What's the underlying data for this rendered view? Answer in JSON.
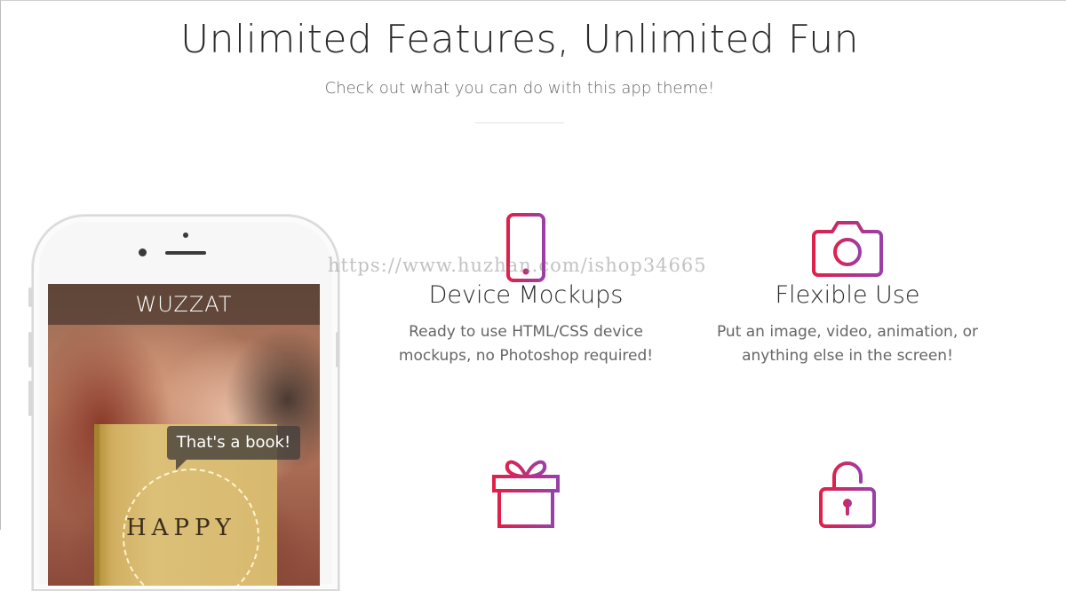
{
  "section": {
    "title": "Unlimited Features, Unlimited Fun",
    "subtitle": "Check out what you can do with this app theme!"
  },
  "phone_screen": {
    "app_title": "WUZZAT",
    "bubble": "That's a book!",
    "book_text": "HAPPY"
  },
  "features": [
    {
      "icon": "smartphone-icon",
      "title": "Device Mockups",
      "desc_line1": "Ready to use HTML/CSS device",
      "desc_line2": "mockups, no Photoshop required!"
    },
    {
      "icon": "camera-icon",
      "title": "Flexible Use",
      "desc_line1": "Put an image, video, animation, or",
      "desc_line2": "anything else in the screen!"
    },
    {
      "icon": "gift-icon"
    },
    {
      "icon": "unlock-icon"
    }
  ],
  "watermark": "https://www.huzhan.com/ishop34665",
  "colors": {
    "icon_gradient_start": "#e0204a",
    "icon_gradient_end": "#9a3fa8",
    "heading": "#2b2b2b",
    "text_muted": "#666666"
  }
}
